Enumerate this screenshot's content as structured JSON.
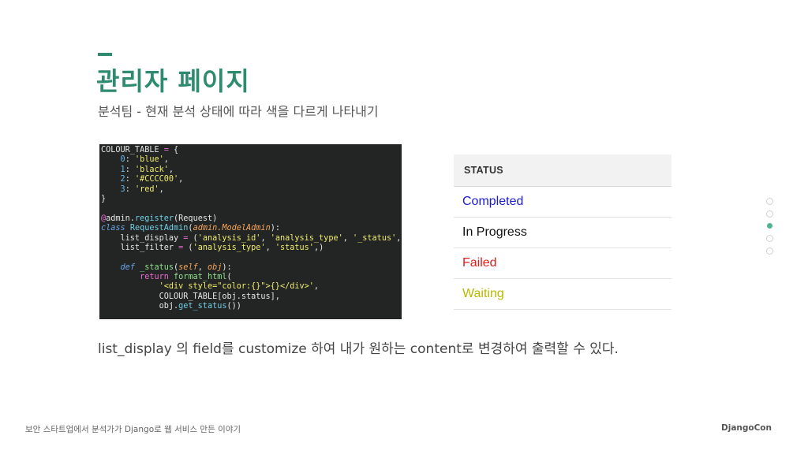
{
  "slide": {
    "title": "관리자 페이지",
    "subtitle": "분석팀 - 현재 분석 상태에 따라 색을 다르게 나타내기",
    "body": "list_display 의 field를 customize 하여 내가 원하는 content로 변경하여 출력할 수 있다.",
    "accent_color": "#2e8b6f"
  },
  "code": {
    "lines": [
      [
        [
          "plain",
          "COLOUR_TABLE "
        ],
        [
          "op",
          "="
        ],
        [
          "plain",
          " {"
        ]
      ],
      [
        [
          "plain",
          "    "
        ],
        [
          "num",
          "0"
        ],
        [
          "plain",
          ": "
        ],
        [
          "str",
          "'blue'"
        ],
        [
          "plain",
          ","
        ]
      ],
      [
        [
          "plain",
          "    "
        ],
        [
          "num",
          "1"
        ],
        [
          "plain",
          ": "
        ],
        [
          "str",
          "'black'"
        ],
        [
          "plain",
          ","
        ]
      ],
      [
        [
          "plain",
          "    "
        ],
        [
          "num",
          "2"
        ],
        [
          "plain",
          ": "
        ],
        [
          "str",
          "'#CCCC00'"
        ],
        [
          "plain",
          ","
        ]
      ],
      [
        [
          "plain",
          "    "
        ],
        [
          "num",
          "3"
        ],
        [
          "plain",
          ": "
        ],
        [
          "str",
          "'red'"
        ],
        [
          "plain",
          ","
        ]
      ],
      [
        [
          "plain",
          "}"
        ]
      ],
      [
        [
          "plain",
          ""
        ]
      ],
      [
        [
          "deco",
          "@"
        ],
        [
          "plain",
          "admin."
        ],
        [
          "meth",
          "register"
        ],
        [
          "plain",
          "(Request)"
        ]
      ],
      [
        [
          "keyword",
          "class "
        ],
        [
          "name",
          "RequestAdmin"
        ],
        [
          "plain",
          "("
        ],
        [
          "param",
          "admin.ModelAdmin"
        ],
        [
          "plain",
          "):"
        ]
      ],
      [
        [
          "plain",
          "    list_display "
        ],
        [
          "op",
          "="
        ],
        [
          "plain",
          " ("
        ],
        [
          "str",
          "'analysis_id'"
        ],
        [
          "plain",
          ", "
        ],
        [
          "str",
          "'analysis_type'"
        ],
        [
          "plain",
          ", "
        ],
        [
          "str",
          "'_status'"
        ],
        [
          "plain",
          ",)"
        ]
      ],
      [
        [
          "plain",
          "    list_filter "
        ],
        [
          "op",
          "="
        ],
        [
          "plain",
          " ("
        ],
        [
          "str",
          "'analysis_type'"
        ],
        [
          "plain",
          ", "
        ],
        [
          "str",
          "'status'"
        ],
        [
          "plain",
          ",)"
        ]
      ],
      [
        [
          "plain",
          ""
        ]
      ],
      [
        [
          "plain",
          "    "
        ],
        [
          "keyword",
          "def "
        ],
        [
          "func",
          "_status"
        ],
        [
          "plain",
          "("
        ],
        [
          "param",
          "self"
        ],
        [
          "plain",
          ", "
        ],
        [
          "param",
          "obj"
        ],
        [
          "plain",
          "):"
        ]
      ],
      [
        [
          "plain",
          "        "
        ],
        [
          "ret",
          "return "
        ],
        [
          "func",
          "format_html"
        ],
        [
          "plain",
          "("
        ]
      ],
      [
        [
          "plain",
          "            "
        ],
        [
          "str",
          "'<div style=\"color:{}\">{}</div>'"
        ],
        [
          "plain",
          ","
        ]
      ],
      [
        [
          "plain",
          "            COLOUR_TABLE[obj.status],"
        ]
      ],
      [
        [
          "plain",
          "            obj."
        ],
        [
          "meth",
          "get_status"
        ],
        [
          "plain",
          "())"
        ]
      ]
    ]
  },
  "status_table": {
    "header": "STATUS",
    "rows": [
      {
        "label": "Completed",
        "color": "#1a1ad6"
      },
      {
        "label": "In Progress",
        "color": "#111111"
      },
      {
        "label": "Failed",
        "color": "#e01b1b"
      },
      {
        "label": "Waiting",
        "color": "#b8b800"
      }
    ]
  },
  "nav": {
    "dots": 5,
    "active_index": 2
  },
  "footer": {
    "left": "보안 스타트업에서 분석가가 Django로 웹 서비스 만든 이야기",
    "right": "DjangoCon"
  }
}
